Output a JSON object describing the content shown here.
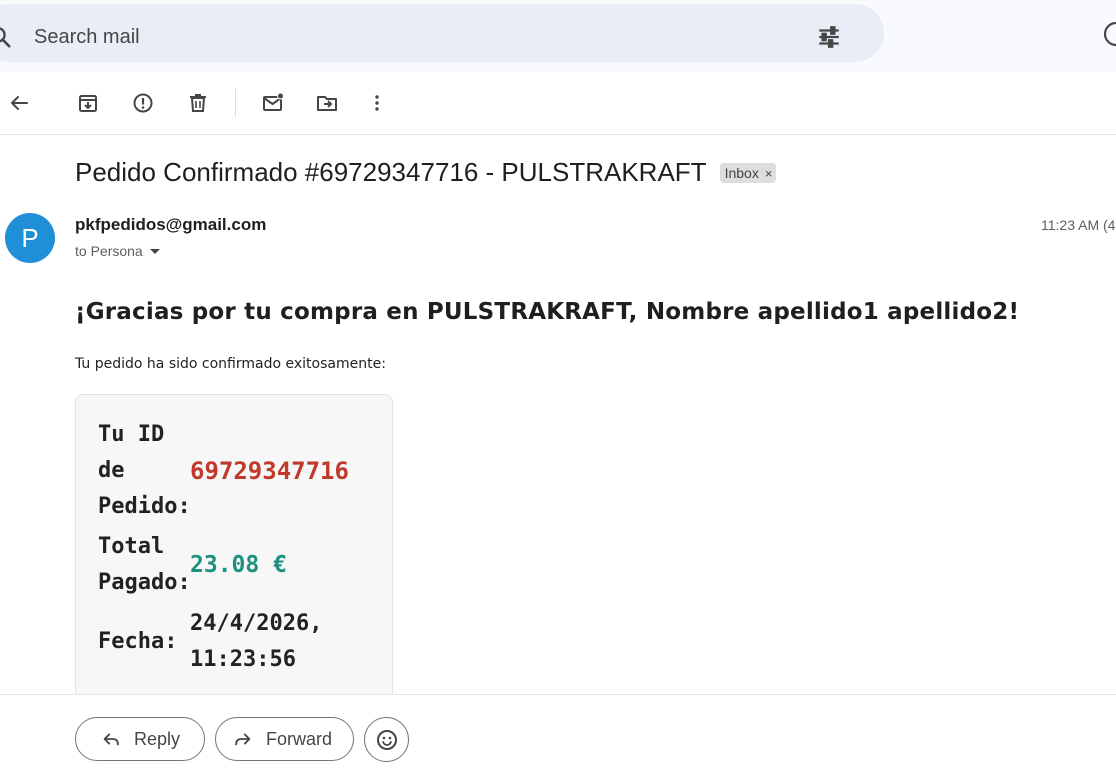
{
  "search": {
    "placeholder": "Search mail"
  },
  "toolbar": {
    "icons": [
      "back-icon",
      "archive-icon",
      "report-spam-icon",
      "delete-icon",
      "mark-unread-icon",
      "move-to-icon",
      "more-icon"
    ]
  },
  "email": {
    "subject": "Pedido Confirmado #69729347716 - PULSTRAKRAFT",
    "label": "Inbox",
    "label_close": "×",
    "avatar_letter": "P",
    "sender": "pkfpedidos@gmail.com",
    "recipient": "to Persona",
    "time": "11:23 AM (4"
  },
  "body": {
    "thanks": "¡Gracias por tu compra en PULSTRAKRAFT, Nombre apellido1 apellido2!",
    "confirm": "Tu pedido ha sido confirmado exitosamente:",
    "order_id_label_1": "Tu ID",
    "order_id_label_2": "de",
    "order_id_label_3": "Pedido:",
    "order_id": "69729347716",
    "total_label_1": "Total",
    "total_label_2": "Pagado:",
    "total": "23.08 €",
    "date_label": "Fecha:",
    "date_1": "24/4/2026,",
    "date_2": "11:23:56"
  },
  "actions": {
    "reply": "Reply",
    "forward": "Forward"
  },
  "colors": {
    "order_id": "#c0392b",
    "total": "#1e9080",
    "avatar": "#1f8fd8"
  }
}
